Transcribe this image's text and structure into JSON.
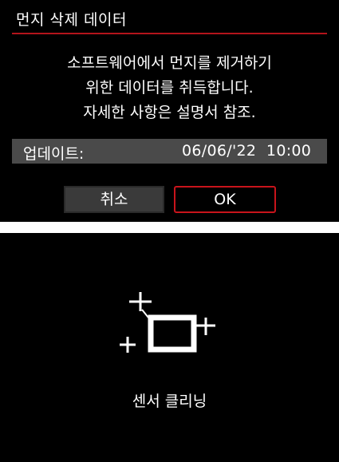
{
  "top_screen": {
    "title": "먼지 삭제 데이터",
    "message_lines": [
      "소프트웨어에서 먼지를 제거하기",
      "위한 데이터를 취득합니다.",
      "자세한 사항은 설명서 참조."
    ],
    "update_label": "업데이트:",
    "update_value": "06/06/'22  10:00",
    "cancel_label": "취소",
    "ok_label": "OK",
    "colors": {
      "accent": "#c8141b",
      "row_bg": "#4a4a4a",
      "cancel_bg": "#3a3a3a"
    }
  },
  "bottom_screen": {
    "icon": "sensor-cleaning-icon",
    "label": "센서 클리닝"
  }
}
